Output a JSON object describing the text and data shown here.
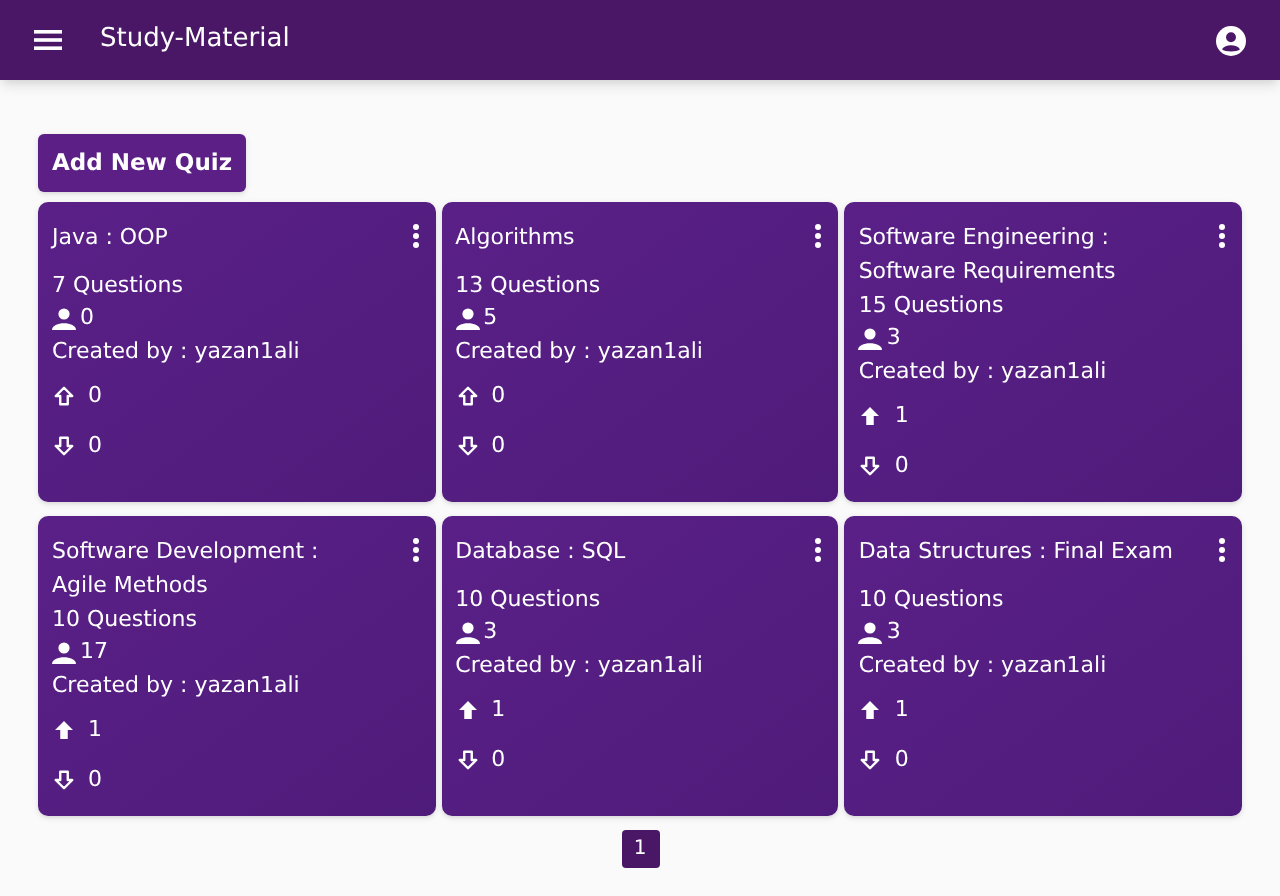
{
  "app_bar": {
    "title": "Study-Material"
  },
  "add_button": "Add New Quiz",
  "quizzes": [
    {
      "title": "Java : OOP",
      "questions": "7 Questions",
      "participants": "0",
      "created_by": "Created by : yazan1ali",
      "upvotes": "0",
      "upvoted": false,
      "downvotes": "0",
      "downvoted": false
    },
    {
      "title": "Algorithms",
      "questions": "13 Questions",
      "participants": "5",
      "created_by": "Created by : yazan1ali",
      "upvotes": "0",
      "upvoted": false,
      "downvotes": "0",
      "downvoted": false
    },
    {
      "title": "Software Engineering : Software Requirements",
      "questions": "15 Questions",
      "participants": "3",
      "created_by": "Created by : yazan1ali",
      "upvotes": "1",
      "upvoted": true,
      "downvotes": "0",
      "downvoted": false
    },
    {
      "title": "Software Development : Agile Methods",
      "questions": "10 Questions",
      "participants": "17",
      "created_by": "Created by : yazan1ali",
      "upvotes": "1",
      "upvoted": true,
      "downvotes": "0",
      "downvoted": false
    },
    {
      "title": "Database : SQL",
      "questions": "10 Questions",
      "participants": "3",
      "created_by": "Created by : yazan1ali",
      "upvotes": "1",
      "upvoted": true,
      "downvotes": "0",
      "downvoted": false
    },
    {
      "title": "Data Structures : Final Exam",
      "questions": "10 Questions",
      "participants": "3",
      "created_by": "Created by : yazan1ali",
      "upvotes": "1",
      "upvoted": true,
      "downvotes": "0",
      "downvoted": false
    }
  ],
  "pagination": [
    {
      "label": "1",
      "selected": true
    }
  ]
}
